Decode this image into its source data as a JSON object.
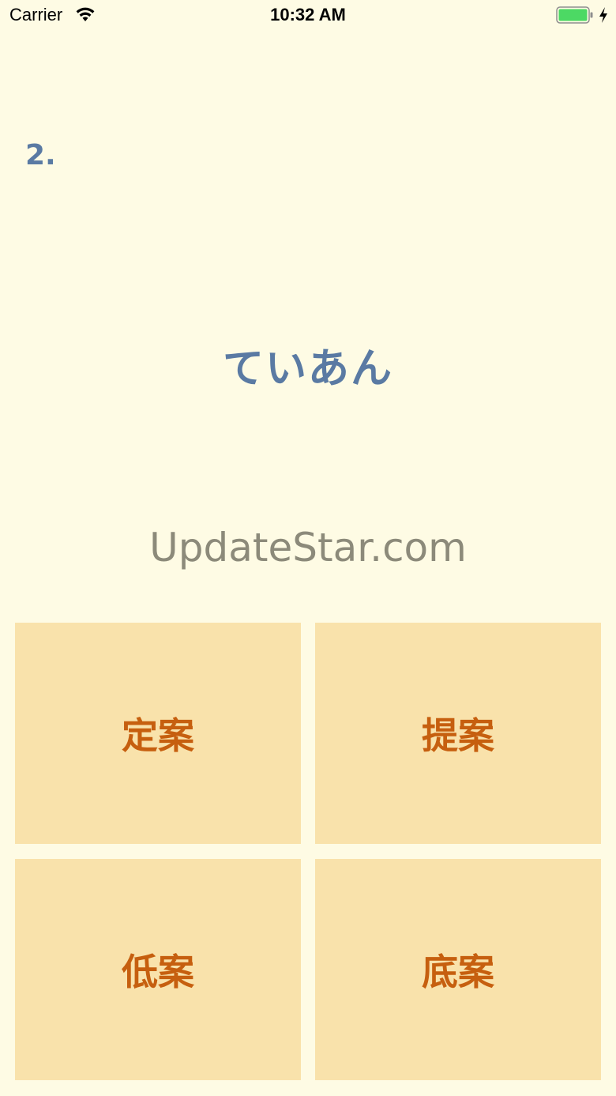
{
  "status_bar": {
    "carrier": "Carrier",
    "time": "10:32 AM",
    "wifi_icon": "wifi-icon",
    "battery_icon": "battery-icon",
    "charging_icon": "lightning-bolt-icon",
    "battery_color": "#4cd964"
  },
  "question": {
    "number": "2.",
    "reading": "ていあん"
  },
  "watermark": "UpdateStar.com",
  "answers": [
    {
      "label": "定案"
    },
    {
      "label": "提案"
    },
    {
      "label": "低案"
    },
    {
      "label": "底案"
    }
  ],
  "colors": {
    "background": "#fefbe4",
    "question_text": "#5a7aa3",
    "answer_bg": "#f9e2ab",
    "answer_text": "#c65f0f"
  }
}
